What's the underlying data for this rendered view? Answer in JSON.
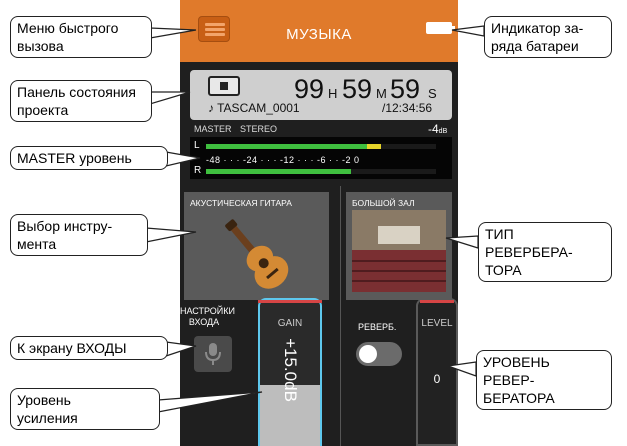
{
  "callouts": {
    "quick_menu": [
      "Меню быстрого",
      "вызова"
    ],
    "project_status": [
      "Панель состояния",
      "проекта"
    ],
    "master_level": "MASTER уровень",
    "instrument_select": [
      "Выбор инстру-",
      "мента"
    ],
    "to_inputs": "К экрану ВХОДЫ",
    "gain_level": [
      "Уровень",
      "усиления"
    ],
    "battery": [
      "Индикатор за-",
      "ряда батареи"
    ],
    "reverb_type": [
      "ТИП РЕВЕРБЕРА-",
      "ТОРА"
    ],
    "reverb_level": [
      "УРОВЕНЬ РЕВЕР-",
      "БЕРАТОРА"
    ]
  },
  "screen": {
    "title": "МУЗЫКА",
    "timer": {
      "h": "99",
      "h_unit": "H",
      "m": "59",
      "m_unit": "M",
      "s": "59",
      "s_unit": "S"
    },
    "project_name": "♪ TASCAM_0001",
    "duration": "/12:34:56",
    "meter": {
      "master": "MASTER",
      "mode": "STEREO",
      "db_value": "-4",
      "db_unit": "dB",
      "ch_l": "L",
      "ch_r": "R",
      "scale": "-48 · · · -24 · · · -12 · · · -6 · · -2 0",
      "level_l": 0.76,
      "level_r": 0.63
    },
    "instrument_label": "АКУСТИЧЕСКАЯ ГИТАРА",
    "reverb_type_label": "БОЛЬШОЙ ЗАЛ",
    "input_settings": [
      "НАСТРОЙКИ",
      "ВХОДА"
    ],
    "gain_label": "GAIN",
    "gain_value": "+15.0dB",
    "reverb_switch_label": "РЕВЕРБ.",
    "level_label": "LEVEL",
    "level_value": "0"
  },
  "colors": {
    "header": "#e07a2b",
    "meter_green": "#3fbf3f",
    "meter_yellow": "#e6d42a",
    "gain_border": "#5ec8ee"
  }
}
